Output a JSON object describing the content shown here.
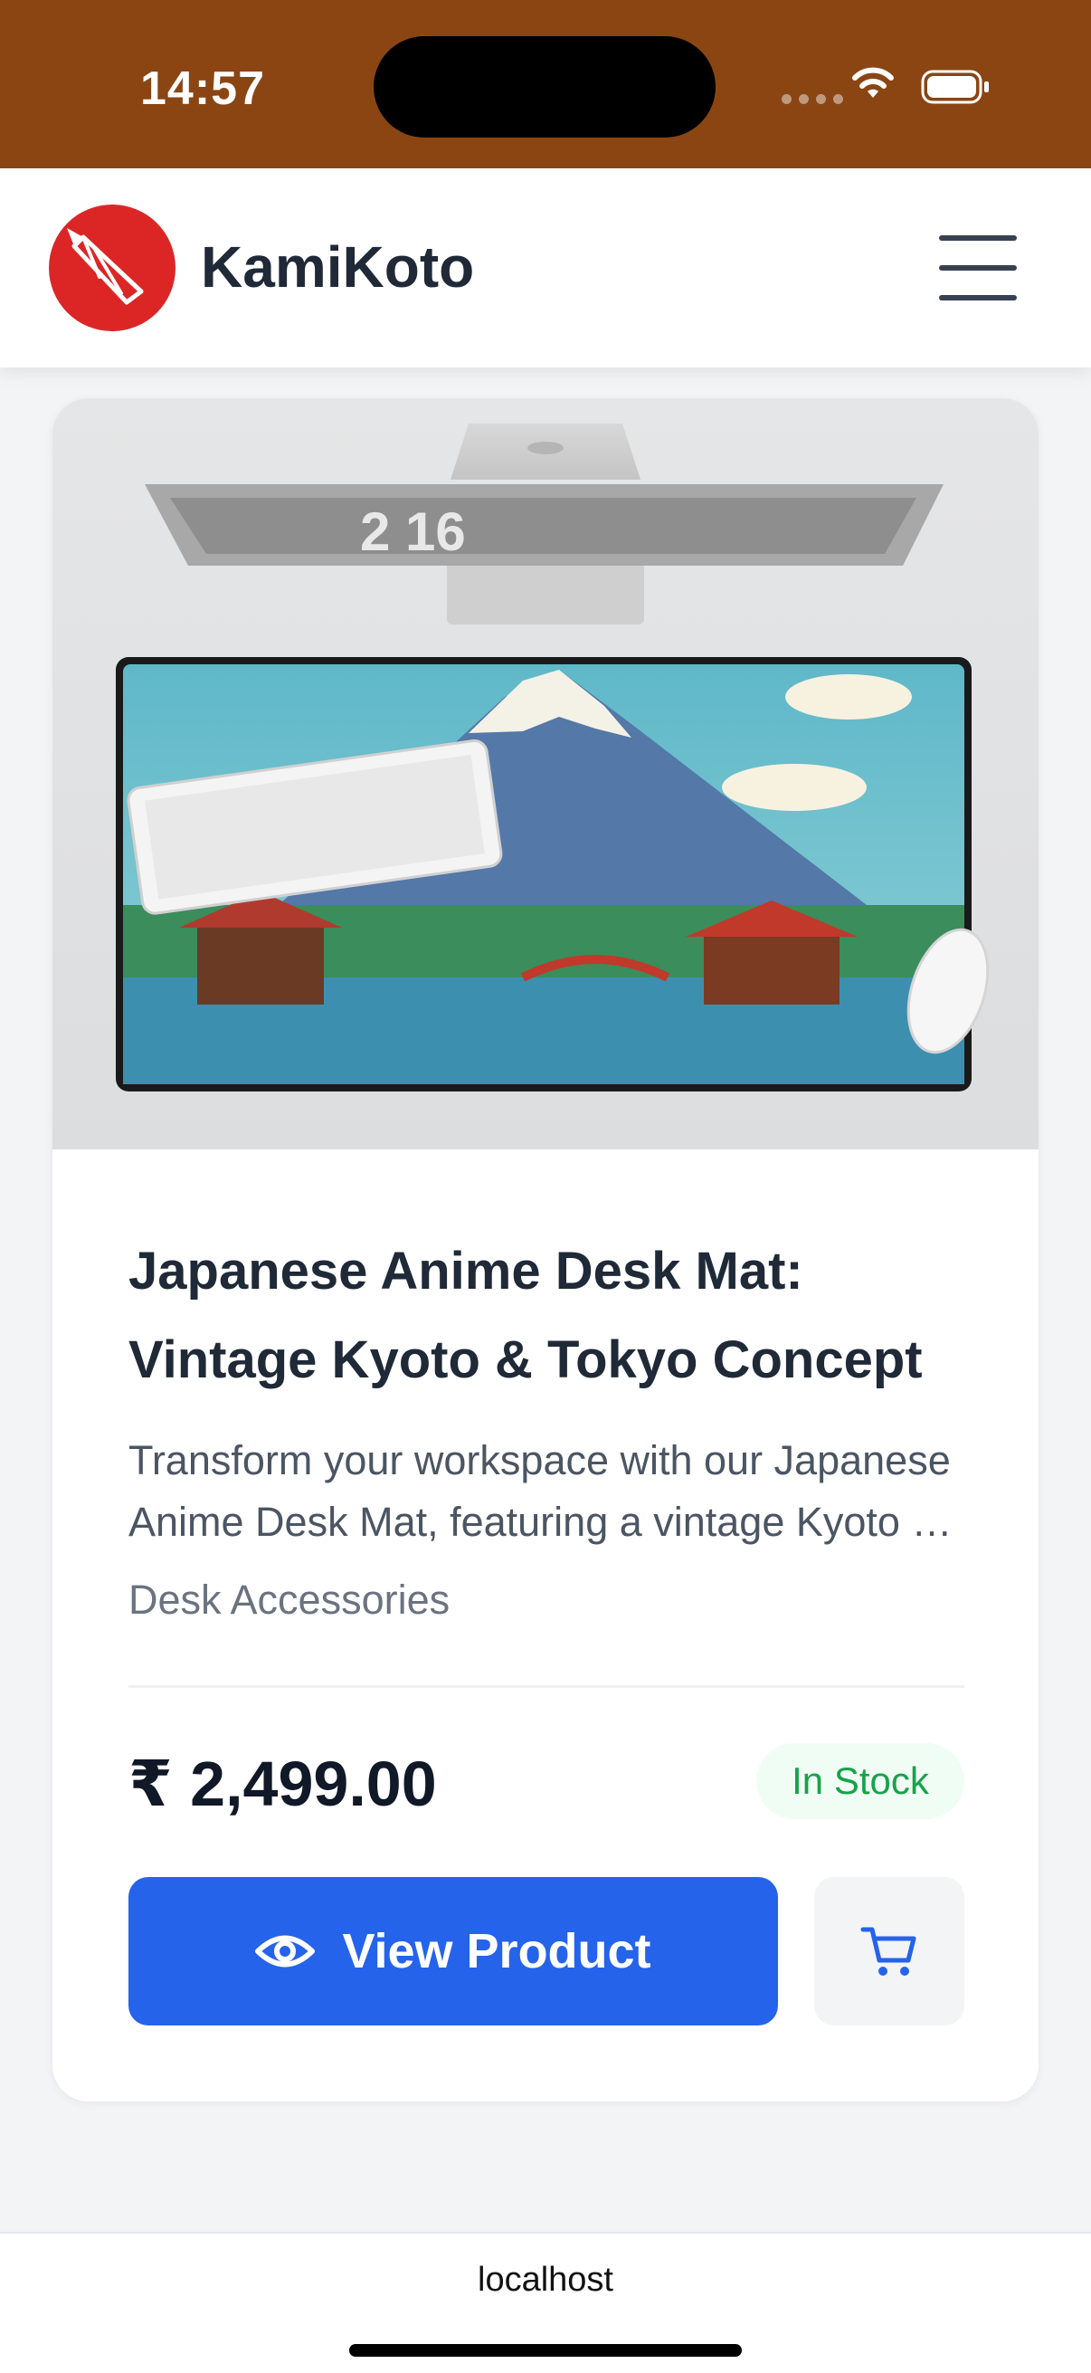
{
  "status_bar": {
    "time": "14:57"
  },
  "header": {
    "brand": "KamiKoto",
    "logo_icon": "paper-plane-pencil-icon",
    "menu_icon": "hamburger-menu-icon"
  },
  "product": {
    "image_clock_text": "2  16",
    "title": "Japanese Anime Desk Mat: Vintage Kyoto & Tokyo Concept",
    "description": "Transform your workspace with our Japanese Anime Desk Mat, featuring a vintage Kyoto & Tokyo design",
    "category": "Desk Accessories",
    "price": "₹ 2,499.00",
    "stock_status": "In Stock",
    "view_button_label": "View Product",
    "view_icon": "eye-icon",
    "cart_icon": "cart-icon"
  },
  "browser": {
    "url": "localhost"
  },
  "colors": {
    "status_bar": "#8b4513",
    "accent": "#2563eb",
    "logo": "#dc2626",
    "stock_green": "#16a34a"
  }
}
